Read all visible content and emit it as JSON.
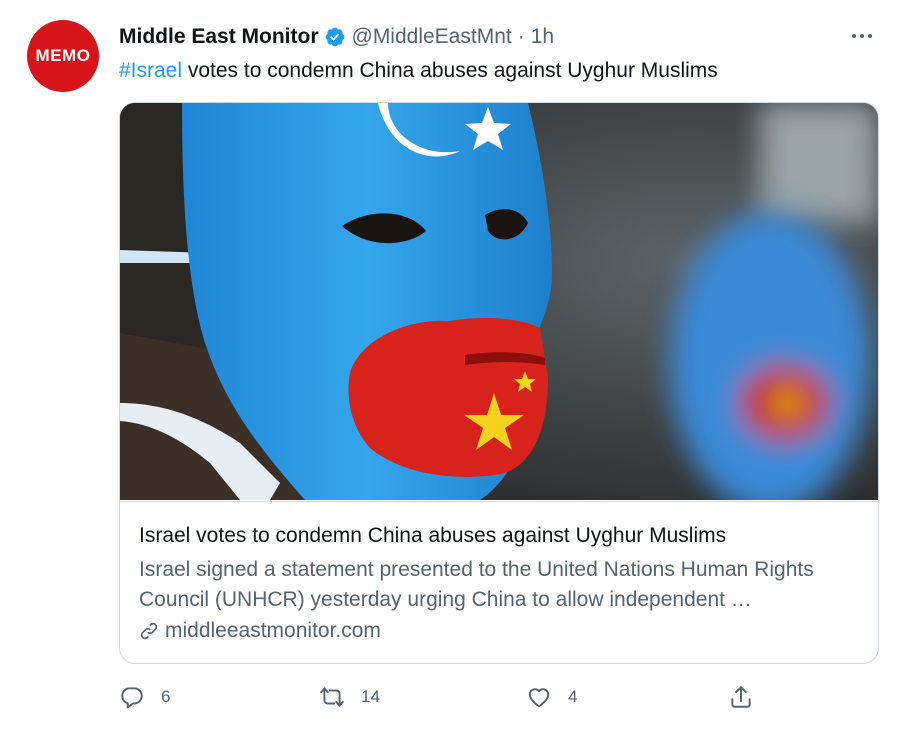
{
  "account": {
    "avatar_text": "MEMO",
    "avatar_color": "#d7141a",
    "name": "Middle East Monitor",
    "verified_icon": "verified-badge-icon",
    "handle": "@MiddleEastMnt",
    "separator": "·",
    "time": "1h"
  },
  "tweet": {
    "hashtag": "#Israel",
    "text": " votes to condemn China abuses against Uyghur Muslims"
  },
  "card": {
    "image": "blue mask with red lips and yellow star",
    "title": "Israel votes to condemn China abuses against Uyghur Muslims",
    "description": "Israel signed a statement presented to the United Nations Human Rights Council (UNHCR) yesterday urging China to allow independent …",
    "domain": "middleeastmonitor.com",
    "domain_icon": "link-icon"
  },
  "actions": {
    "reply": {
      "icon": "reply-icon",
      "count": "6"
    },
    "retweet": {
      "icon": "retweet-icon",
      "count": "14"
    },
    "like": {
      "icon": "heart-icon",
      "count": "4"
    },
    "share": {
      "icon": "share-icon"
    }
  },
  "colors": {
    "accent": "#1d9bf0",
    "text": "#0f1419",
    "muted": "#536471",
    "border": "#cfd9de"
  }
}
